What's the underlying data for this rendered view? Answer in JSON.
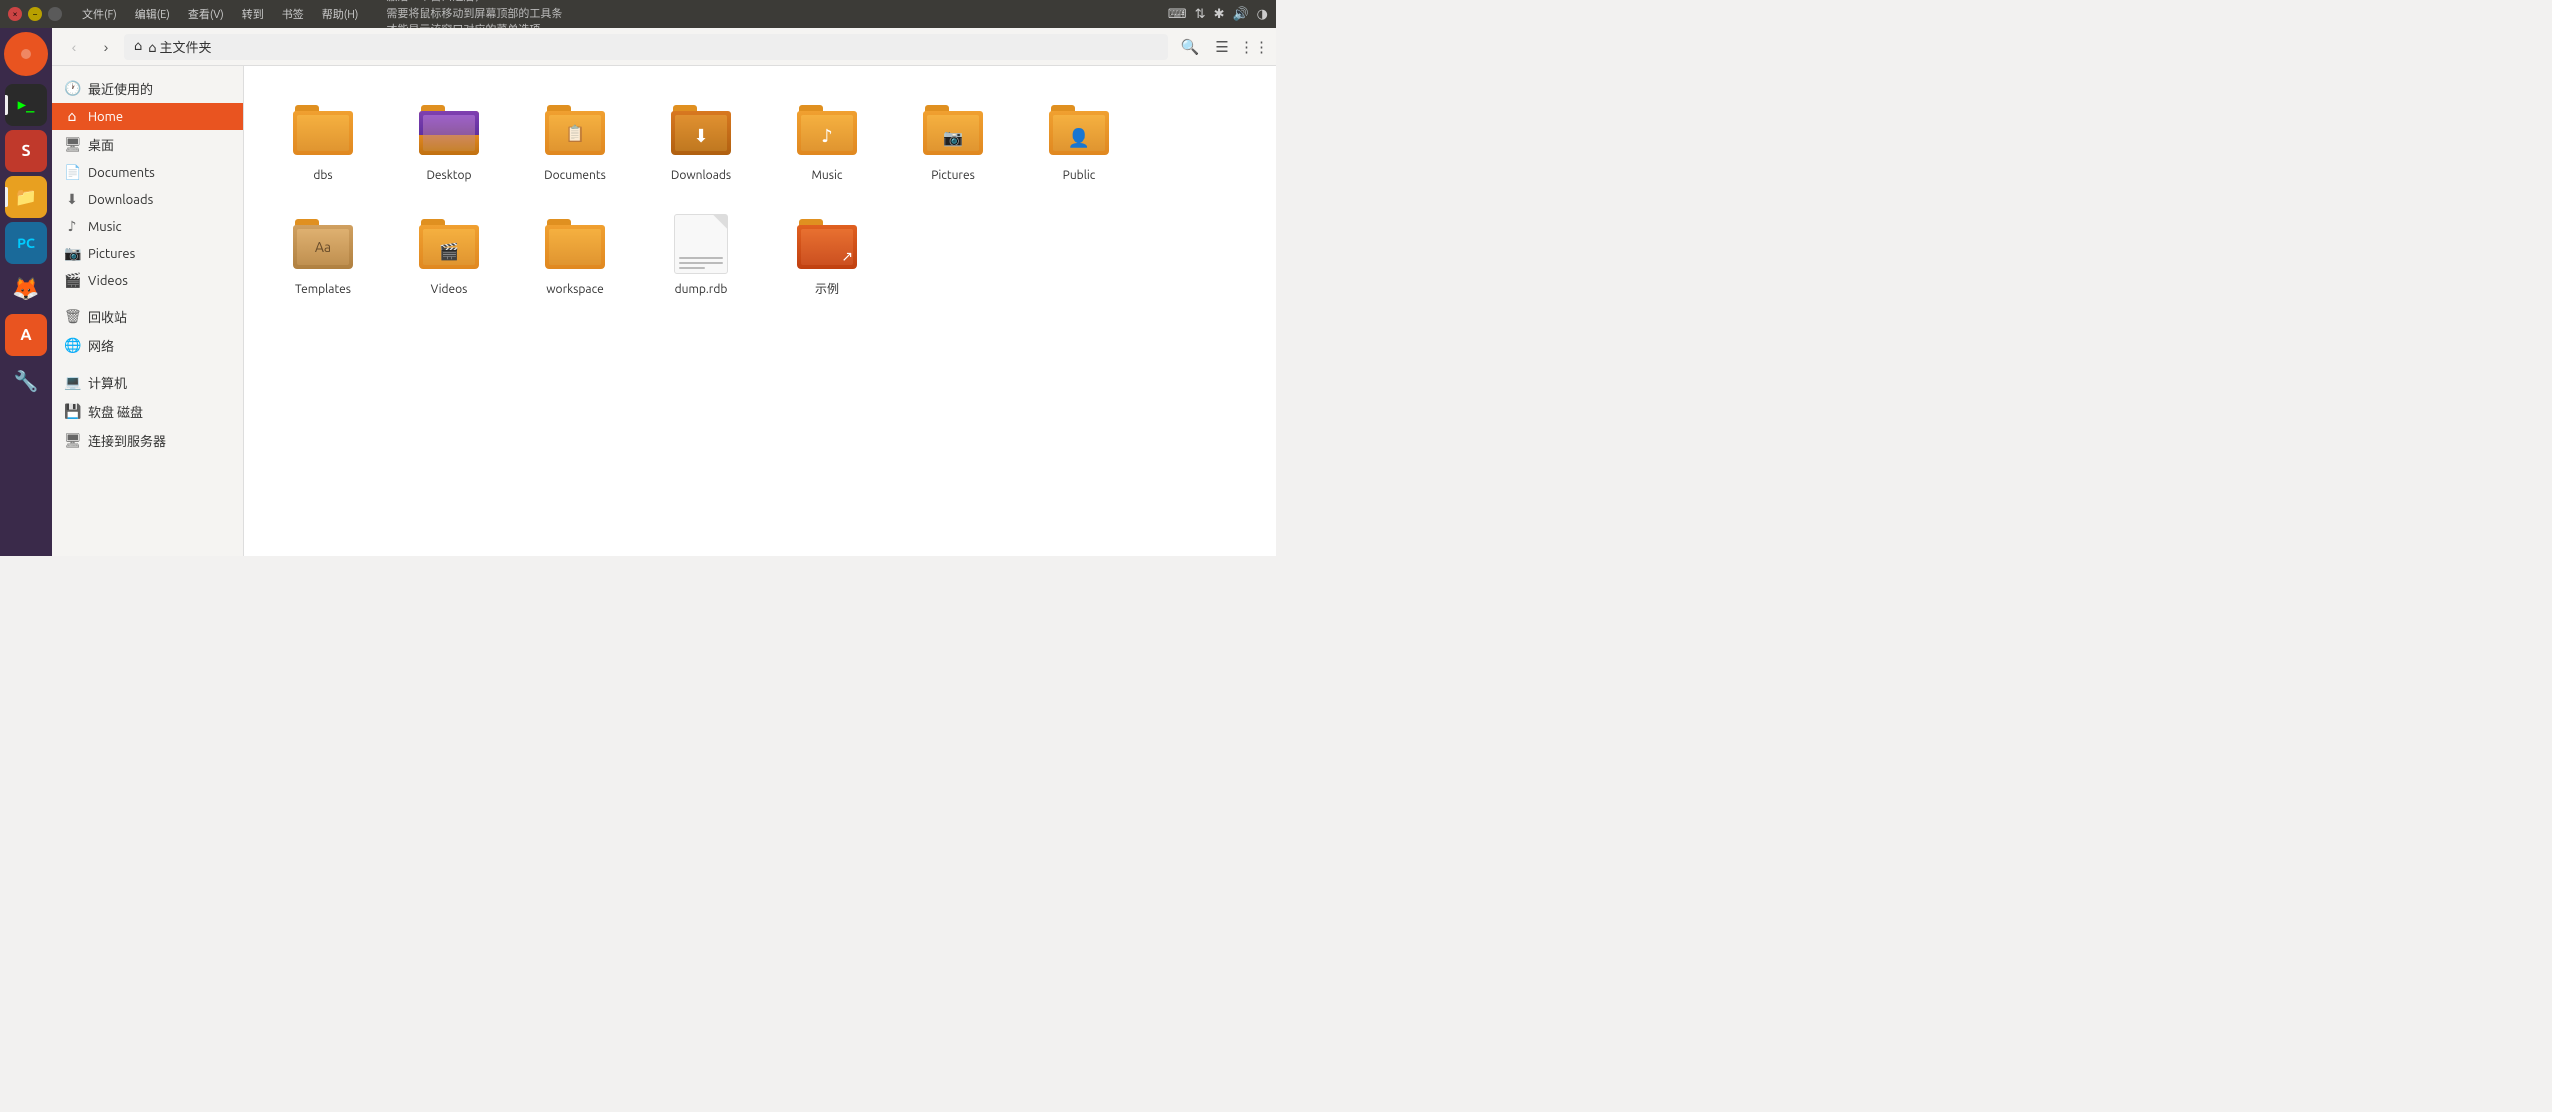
{
  "menubar": {
    "window_controls": {
      "close": "×",
      "minimize": "−",
      "maximize": "□"
    },
    "menus": [
      "文件(F)",
      "编辑(E)",
      "查看(V)",
      "转到",
      "书签",
      "帮助(H)"
    ],
    "tooltip": "激活一个窗口之后，\n需要将鼠标移动到屏幕顶部的工具条\n才能显示该窗口对应的菜单选项",
    "status_icons": [
      "⌨",
      "↕",
      "🔷",
      "🔊",
      "◑"
    ]
  },
  "toolbar": {
    "back_label": "‹",
    "forward_label": "›",
    "home_label": "⌂ 主文件夹",
    "search_icon": "🔍",
    "list_icon": "☰",
    "grid_icon": "⋮⋮"
  },
  "sidebar": {
    "items": [
      {
        "id": "recent",
        "icon": "🕐",
        "label": "最近使用的"
      },
      {
        "id": "home",
        "icon": "⌂",
        "label": "Home",
        "active": true
      },
      {
        "id": "desktop",
        "icon": "🖥",
        "label": "桌面"
      },
      {
        "id": "documents",
        "icon": "📄",
        "label": "Documents"
      },
      {
        "id": "downloads",
        "icon": "⬇",
        "label": "Downloads"
      },
      {
        "id": "music",
        "icon": "♪",
        "label": "Music"
      },
      {
        "id": "pictures",
        "icon": "📷",
        "label": "Pictures"
      },
      {
        "id": "videos",
        "icon": "🎬",
        "label": "Videos"
      },
      {
        "id": "trash",
        "icon": "🗑",
        "label": "回收站"
      },
      {
        "id": "network",
        "icon": "🌐",
        "label": "网络"
      },
      {
        "id": "computer",
        "icon": "💻",
        "label": "计算机"
      },
      {
        "id": "floppy",
        "icon": "💾",
        "label": "软盘 磁盘"
      },
      {
        "id": "connect",
        "icon": "🖥",
        "label": "连接到服务器"
      }
    ]
  },
  "dock": {
    "items": [
      {
        "id": "ubuntu",
        "icon": "🐧",
        "label": "Ubuntu"
      },
      {
        "id": "terminal",
        "icon": "▶",
        "label": "Terminal",
        "active": true
      },
      {
        "id": "texteditor",
        "icon": "S",
        "label": "Text Editor"
      },
      {
        "id": "filemanager",
        "icon": "📁",
        "label": "File Manager",
        "active": true
      },
      {
        "id": "ide",
        "icon": "💻",
        "label": "IDE"
      },
      {
        "id": "browser",
        "icon": "🦊",
        "label": "Firefox"
      },
      {
        "id": "appstore",
        "icon": "A",
        "label": "App Store"
      },
      {
        "id": "settings",
        "icon": "🔧",
        "label": "Settings"
      }
    ]
  },
  "files": [
    {
      "id": "dbs",
      "label": "dbs",
      "type": "folder",
      "variant": "plain"
    },
    {
      "id": "desktop",
      "label": "Desktop",
      "type": "folder",
      "variant": "desktop"
    },
    {
      "id": "documents",
      "label": "Documents",
      "type": "folder",
      "variant": "documents"
    },
    {
      "id": "downloads",
      "label": "Downloads",
      "type": "folder",
      "variant": "downloads"
    },
    {
      "id": "music",
      "label": "Music",
      "type": "folder",
      "variant": "music"
    },
    {
      "id": "pictures",
      "label": "Pictures",
      "type": "folder",
      "variant": "pictures"
    },
    {
      "id": "public",
      "label": "Public",
      "type": "folder",
      "variant": "public"
    },
    {
      "id": "templates",
      "label": "Templates",
      "type": "folder",
      "variant": "templates"
    },
    {
      "id": "videos",
      "label": "Videos",
      "type": "folder",
      "variant": "videos"
    },
    {
      "id": "workspace",
      "label": "workspace",
      "type": "folder",
      "variant": "plain"
    },
    {
      "id": "dumprdb",
      "label": "dump.rdb",
      "type": "file",
      "variant": "document"
    },
    {
      "id": "example",
      "label": "示例",
      "type": "folder",
      "variant": "example"
    }
  ]
}
